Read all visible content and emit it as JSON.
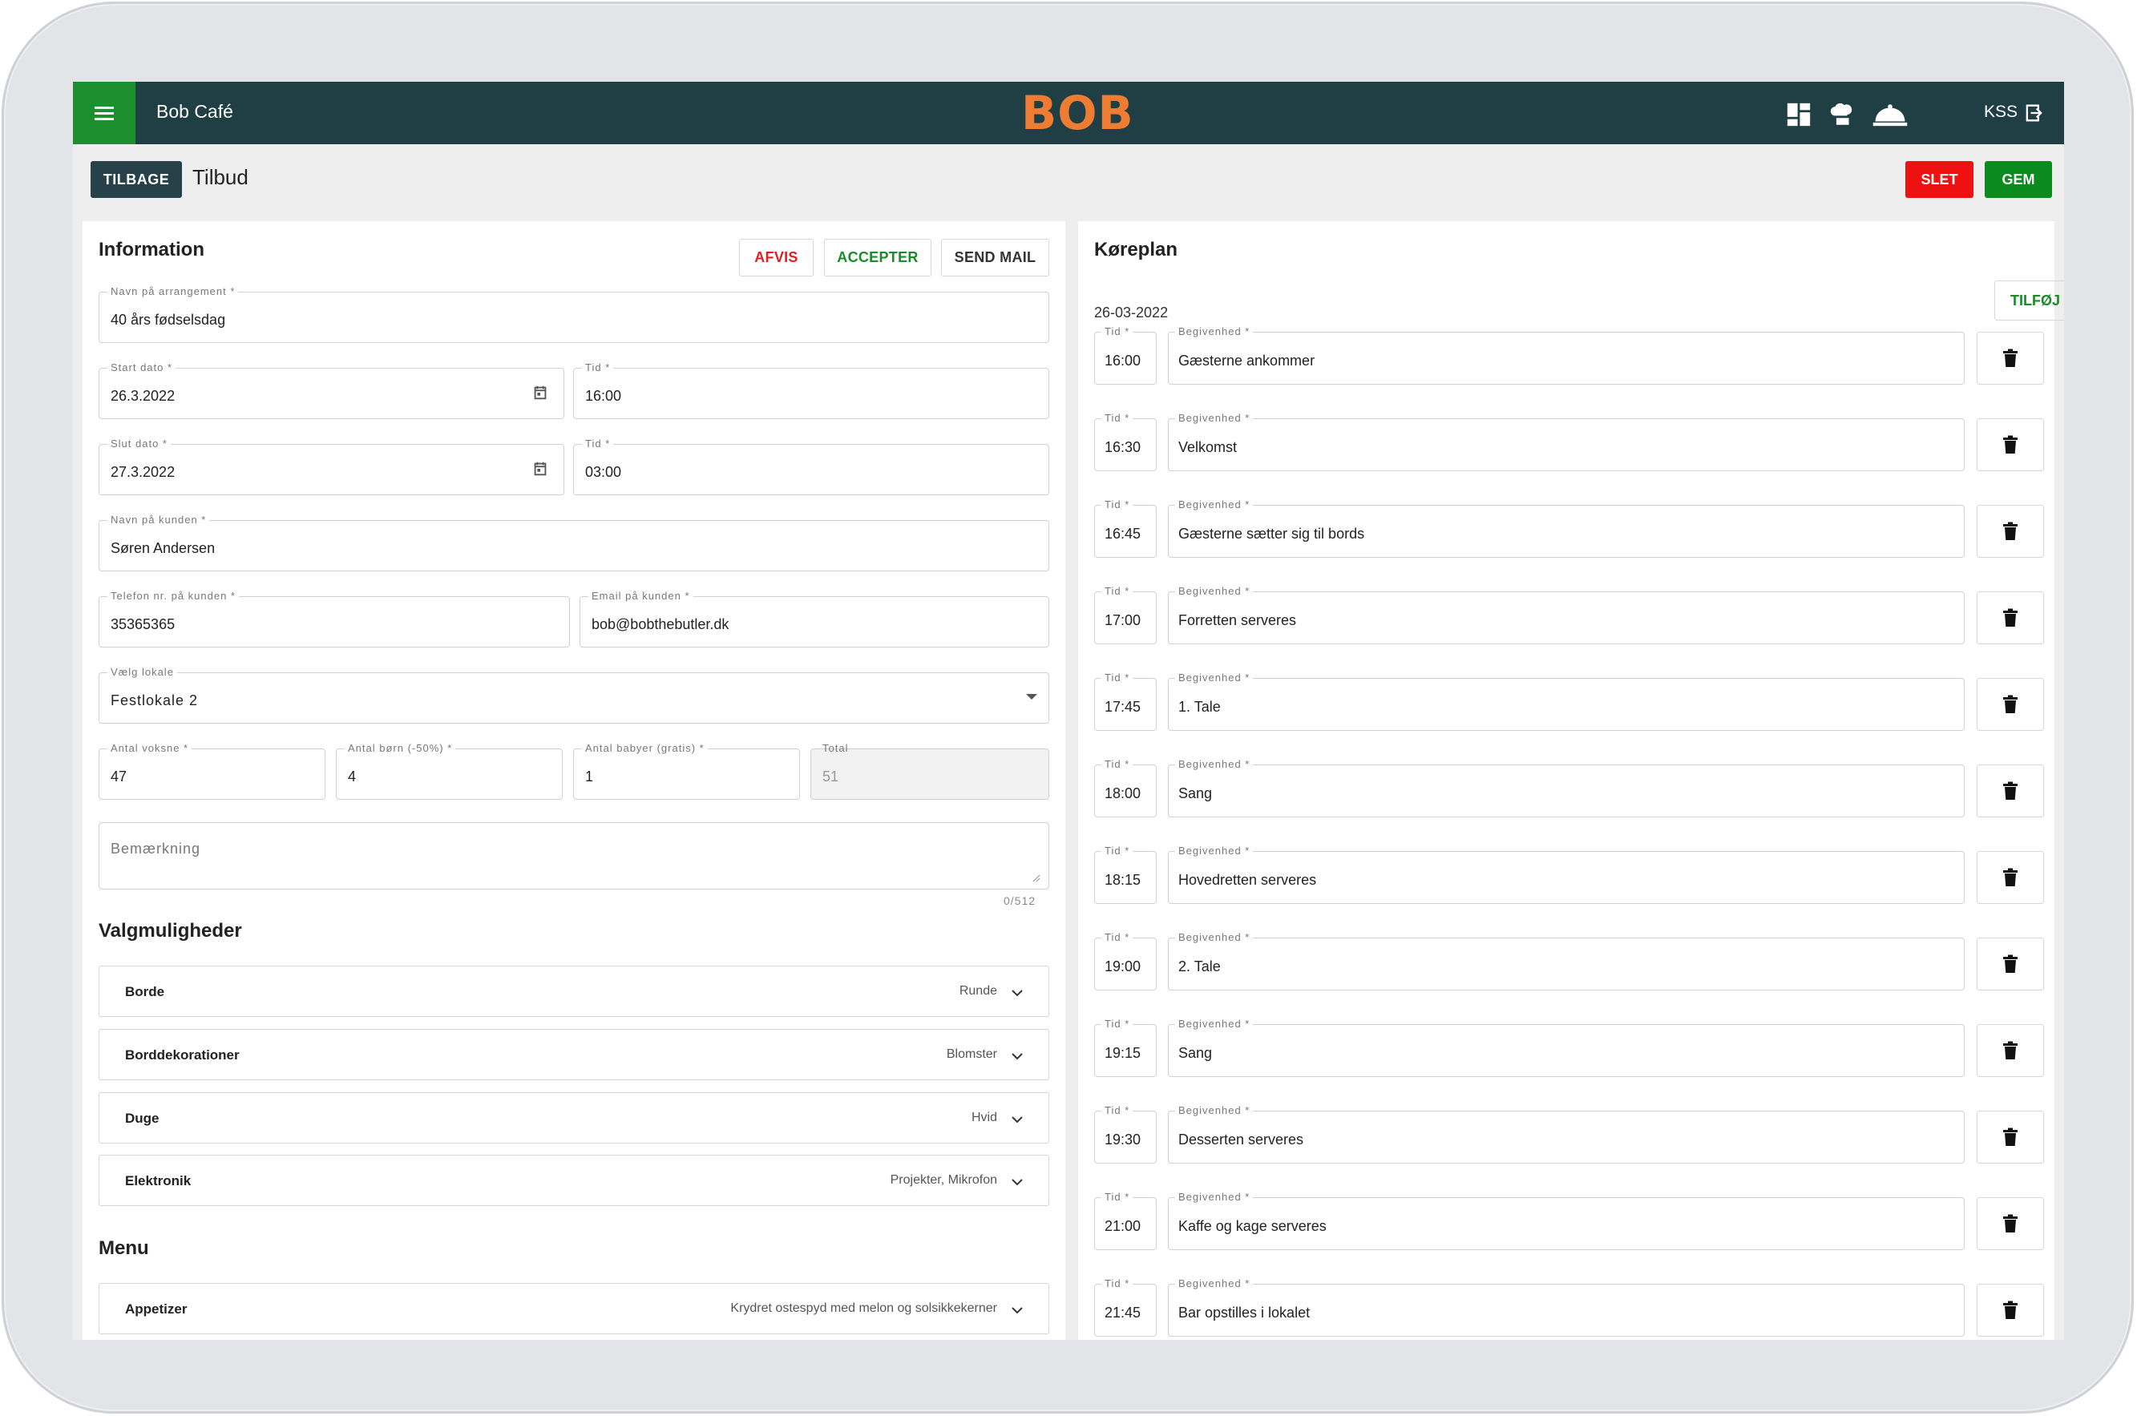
{
  "topbar": {
    "venue": "Bob Café",
    "logo": "BOB",
    "user": "KSS",
    "icons": [
      "menu-icon",
      "dashboard-grid-icon",
      "chef-hat-icon",
      "food-cloche-icon",
      "logout-icon"
    ]
  },
  "header": {
    "back_label": "TILBAGE",
    "title": "Tilbud",
    "delete_label": "SLET",
    "save_label": "GEM"
  },
  "colors": {
    "topbar": "#1f3f45",
    "menu_button": "#1e8f2e",
    "logo": "#ee7d33",
    "delete": "#ee1111",
    "save": "#0b8a1d",
    "reject_text": "#e02020",
    "accept_text": "#1a8a2a"
  },
  "information": {
    "title": "Information",
    "reject_label": "AFVIS",
    "accept_label": "ACCEPTER",
    "mail_label": "SEND MAIL",
    "event_name": {
      "label": "Navn på arrangement *",
      "value": "40 års fødselsdag"
    },
    "start_date": {
      "label": "Start dato *",
      "value": "26.3.2022"
    },
    "start_time": {
      "label": "Tid *",
      "value": "16:00"
    },
    "end_date": {
      "label": "Slut dato *",
      "value": "27.3.2022"
    },
    "end_time": {
      "label": "Tid *",
      "value": "03:00"
    },
    "customer_name": {
      "label": "Navn på kunden *",
      "value": "Søren Andersen"
    },
    "customer_phone": {
      "label": "Telefon nr. på kunden *",
      "value": "35365365"
    },
    "customer_email": {
      "label": "Email på kunden *",
      "value": "bob@bobthebutler.dk"
    },
    "venue_select": {
      "label": "Vælg lokale",
      "value": "Festlokale 2"
    },
    "adults": {
      "label": "Antal voksne *",
      "value": "47"
    },
    "children": {
      "label": "Antal børn (-50%) *",
      "value": "4"
    },
    "babies": {
      "label": "Antal babyer (gratis) *",
      "value": "1"
    },
    "total": {
      "label": "Total",
      "value": "51"
    },
    "remark": {
      "placeholder": "Bemærkning",
      "counter": "0/512"
    }
  },
  "options": {
    "title": "Valgmuligheder",
    "items": [
      {
        "label": "Borde",
        "value": "Runde"
      },
      {
        "label": "Borddekorationer",
        "value": "Blomster"
      },
      {
        "label": "Duge",
        "value": "Hvid"
      },
      {
        "label": "Elektronik",
        "value": "Projekter, Mikrofon"
      }
    ]
  },
  "menu": {
    "title": "Menu",
    "items": [
      {
        "label": "Appetizer",
        "value": "Krydret ostespyd med melon og solsikkekerner"
      }
    ]
  },
  "schedule": {
    "title": "Køreplan",
    "date": "26-03-2022",
    "add_label": "TILFØJ",
    "time_label": "Tid *",
    "event_label": "Begivenhed *",
    "rows": [
      {
        "time": "16:00",
        "event": "Gæsterne ankommer"
      },
      {
        "time": "16:30",
        "event": "Velkomst"
      },
      {
        "time": "16:45",
        "event": "Gæsterne sætter sig til bords"
      },
      {
        "time": "17:00",
        "event": "Forretten serveres"
      },
      {
        "time": "17:45",
        "event": "1. Tale"
      },
      {
        "time": "18:00",
        "event": "Sang"
      },
      {
        "time": "18:15",
        "event": "Hovedretten serveres"
      },
      {
        "time": "19:00",
        "event": "2. Tale"
      },
      {
        "time": "19:15",
        "event": "Sang"
      },
      {
        "time": "19:30",
        "event": "Desserten serveres"
      },
      {
        "time": "21:00",
        "event": "Kaffe og kage serveres"
      },
      {
        "time": "21:45",
        "event": "Bar opstilles i lokalet"
      }
    ]
  }
}
